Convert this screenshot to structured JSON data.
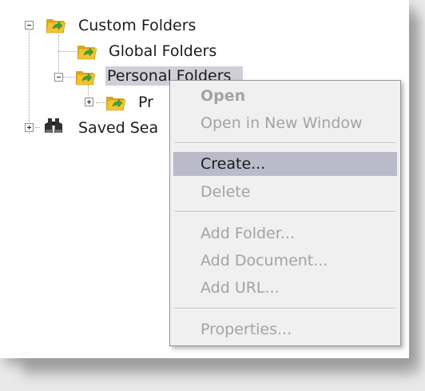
{
  "tree": {
    "custom_folders": {
      "label": "Custom Folders",
      "expander": "−"
    },
    "global_folders": {
      "label": "Global Folders"
    },
    "personal_folders": {
      "label": "Personal Folders",
      "expander": "−"
    },
    "child_folder": {
      "label": "Pr",
      "expander": "+"
    },
    "saved_searches": {
      "label": "Saved Sea",
      "expander": "+"
    }
  },
  "icons": {
    "folder": "folder-with-green-arrow-icon",
    "saved_searches": "binoculars-icon"
  },
  "context_menu": {
    "items": [
      {
        "label": "Open",
        "enabled": false,
        "bold": true
      },
      {
        "label": "Open in New Window",
        "enabled": false
      },
      {
        "label": "Create...",
        "enabled": true,
        "highlighted": true
      },
      {
        "label": "Delete",
        "enabled": false
      },
      {
        "label": "Add Folder...",
        "enabled": false
      },
      {
        "label": "Add Document...",
        "enabled": false
      },
      {
        "label": "Add URL...",
        "enabled": false
      },
      {
        "label": "Properties...",
        "enabled": false
      }
    ]
  },
  "colors": {
    "selection": "#cfcfd8",
    "menu_highlight": "#babacb",
    "disabled_text": "#a3a3a3",
    "folder_yellow": "#f2c230",
    "folder_arrow": "#3fa23a"
  }
}
